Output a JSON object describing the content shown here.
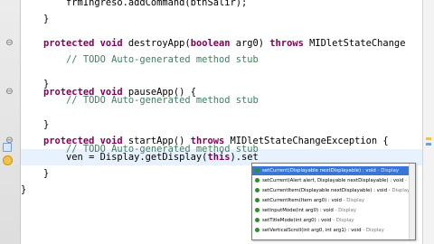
{
  "editor": {
    "lines": [
      {
        "indent": "        ",
        "kw": "",
        "text": "frmIngreso.addCommand(btnSalir);",
        "cm": ""
      },
      {
        "indent": "    ",
        "kw": "",
        "text": "}",
        "cm": ""
      },
      {
        "indent": "",
        "kw": "",
        "text": "",
        "cm": ""
      },
      {
        "indent": "    ",
        "kw": "protected void",
        "text": " destroyApp(",
        "kw2": "boolean",
        "text2": " arg0) ",
        "kw3": "throws",
        "text3": " MIDletStateChange",
        "cm": ""
      },
      {
        "indent": "        ",
        "kw": "",
        "text": "",
        "cm": "// TODO Auto-generated method stub"
      },
      {
        "indent": "",
        "kw": "",
        "text": "",
        "cm": ""
      },
      {
        "indent": "    ",
        "kw": "",
        "text": "}",
        "cm": ""
      },
      {
        "indent": "    ",
        "kw": "protected void",
        "text": " pauseApp() {",
        "cm": ""
      },
      {
        "indent": "        ",
        "kw": "",
        "text": "",
        "cm": "// TODO Auto-generated method stub"
      },
      {
        "indent": "",
        "kw": "",
        "text": "",
        "cm": ""
      },
      {
        "indent": "    ",
        "kw": "",
        "text": "}",
        "cm": ""
      },
      {
        "indent": "    ",
        "kw": "protected void",
        "text": " startApp() ",
        "kw2": "throws",
        "text2": " MIDletStateChangeException {",
        "cm": ""
      },
      {
        "indent": "        ",
        "kw": "",
        "text": "",
        "cm": "// TODO Auto-generated method stub"
      },
      {
        "indent": "        ",
        "kw": "",
        "text": "ven = Display.getDisplay(",
        "kw2": "this",
        "text2": ").set",
        "cm": ""
      },
      {
        "indent": "    ",
        "kw": "",
        "text": "}",
        "cm": ""
      },
      {
        "indent": "",
        "kw": "",
        "text": "}",
        "cm": ""
      }
    ]
  },
  "gutter": {
    "fold_glyph": "⊖",
    "markers": [
      "warning-marker",
      "task-marker"
    ]
  },
  "content_assist": {
    "proposals": [
      {
        "name": "setCurrent(Displayable nextDisplayable) : void",
        "owner": " - Display",
        "selected": true
      },
      {
        "name": "setCurrent(Alert alert, Displayable nextDisplayable) : void",
        "owner": " - Display",
        "selected": false
      },
      {
        "name": "setCurrentItem(Displayable nextDisplayable) : void",
        "owner": " - Display",
        "selected": false
      },
      {
        "name": "setCurrentItem(Item arg0) : void",
        "owner": " - Display",
        "selected": false
      },
      {
        "name": "setInputMode(int arg0) : void",
        "owner": " - Display",
        "selected": false
      },
      {
        "name": "setTitleMode(int arg0) : void",
        "owner": " - Display",
        "selected": false
      },
      {
        "name": "setVerticalScroll(int arg0, int arg1) : void",
        "owner": " - Display",
        "selected": false
      }
    ]
  },
  "colors": {
    "keyword": "#7f0055",
    "comment": "#3f7f5f",
    "selection": "#3875d7",
    "current_line": "#e8f2fe"
  }
}
